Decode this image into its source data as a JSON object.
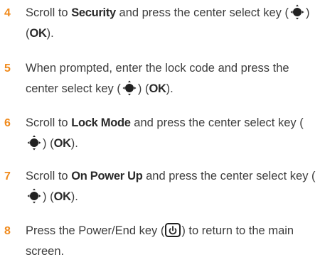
{
  "steps": [
    {
      "number": "4",
      "scroll_to": "Scroll to",
      "target": "Security",
      "rest": "and press the center select key (",
      "close": ") (",
      "key": "OK",
      "end": ")."
    },
    {
      "number": "5",
      "line": "When prompted, enter the lock code and press the center select key (",
      "close": ") (",
      "key": "OK",
      "end": ")."
    },
    {
      "number": "6",
      "scroll_to": "Scroll to",
      "target": "Lock Mode",
      "rest": "and press the center select key (",
      "close": ") (",
      "key": "OK",
      "end": ")."
    },
    {
      "number": "7",
      "scroll_to": "Scroll to",
      "target": "On Power Up",
      "rest": "and press the center select key (",
      "close": ") (",
      "key": "OK",
      "end": ")."
    },
    {
      "number": "8",
      "line": "Press the Power/End key (",
      "end": ") to return to the main screen."
    }
  ],
  "icons": {
    "nav_key": "center-select-key-icon",
    "power_key": "power-end-key-icon"
  },
  "colors": {
    "step_number": "#f08a1c",
    "text": "#3d3d3d"
  }
}
